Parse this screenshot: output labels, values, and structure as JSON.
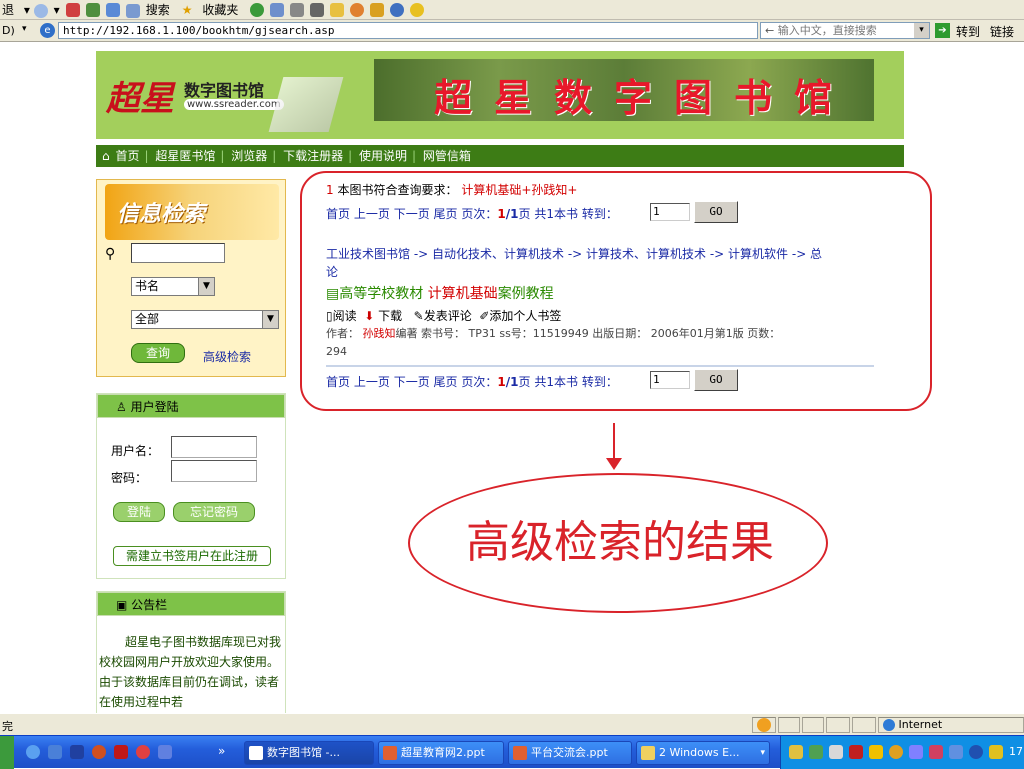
{
  "toolbar": {
    "back": "退",
    "search": "搜索",
    "favorites": "收藏夹"
  },
  "addressbar": {
    "label": "D)",
    "url": "http://192.168.1.100/bookhtm/gjsearch.asp",
    "search_hint": "输入中文，直接搜索",
    "go": "转到",
    "links": "链接"
  },
  "nav": [
    "首页",
    "超星匿书馆",
    "浏览器",
    "下载注册器",
    "使用说明",
    "网管信箱"
  ],
  "banner": {
    "logo_title": "数字图书馆",
    "logo_url": "www.ssreader.com",
    "photo_text": "超星数字图书馆",
    "logo_mark": "超星"
  },
  "search_panel": {
    "title": "信息检索",
    "field_select": "书名",
    "scope_select": "全部",
    "query_button": "查询",
    "advanced_link": "高级检索"
  },
  "login_panel": {
    "title": "用户登陆",
    "username_label": "用户名：",
    "password_label": "密码：",
    "login_button": "登陆",
    "forgot_button": "忘记密码",
    "register_button": "需建立书签用户在此注册"
  },
  "notice_panel": {
    "title": "公告栏",
    "text": "超星电子图书数据库现已对我校校园网用户开放欢迎大家使用。由于该数据库目前仍在调试，读者在使用过程中若"
  },
  "results": {
    "count_num": "1",
    "count_text": "本图书符合查询要求：",
    "query_text": "计算机基础+孙践知+",
    "pager": {
      "first": "首页",
      "prev": "上一页",
      "next": "下一页",
      "last": "尾页",
      "page_label": "页次：",
      "page_cur": "1",
      "page_sep": "/",
      "page_total": "1",
      "page_unit": "页",
      "total": "共1本书",
      "goto": "转到：",
      "goto_value": "1",
      "go_button": "GO"
    },
    "breadcrumb_line1": "工业技术图书馆 -> 自动化技术、计算机技术 -> 计算技术、计算机技术 -> 计算机软件 -> 总",
    "breadcrumb_line2": "论",
    "book_prefix": "高等学校教材 ",
    "book_highlight": "计算机基础",
    "book_suffix": "案例教程",
    "actions": {
      "read": "阅读",
      "download": "下载",
      "comment": "发表评论",
      "bookmark": "添加个人书签"
    },
    "meta_author_label": "作者：",
    "meta_author": "孙践知",
    "meta_rest": "编著 索书号： TP31 ss号：11519949 出版日期： 2006年01月第1版    页数：",
    "meta_pages": "294"
  },
  "annotation": {
    "caption": "高级检索的结果"
  },
  "statusbar": {
    "left": "完",
    "zone": "Internet"
  },
  "taskbar": {
    "arrows": "»",
    "buttons": [
      "数字图书馆 -...",
      "超星教育网2.ppt",
      "平台交流会.ppt",
      "2 Windows E..."
    ],
    "clock": "17:"
  }
}
